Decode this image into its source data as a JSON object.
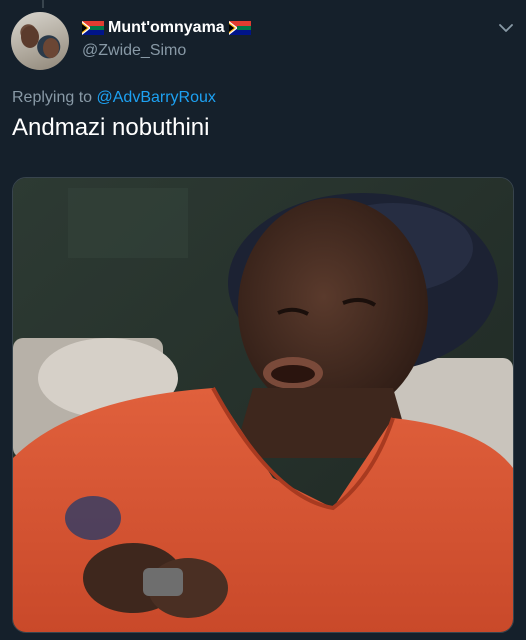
{
  "tweet": {
    "display_name": "Munt'omnyama",
    "handle": "@Zwide_Simo",
    "replying_prefix": "Replying to ",
    "replying_mention": "@AdvBarryRoux",
    "text": "Andmazi nobuthini",
    "icons": [
      "south-africa-flag-icon",
      "chevron-down-icon"
    ]
  },
  "colors": {
    "background": "#15202b",
    "secondary_text": "#8899a6",
    "link": "#1da1f2"
  }
}
